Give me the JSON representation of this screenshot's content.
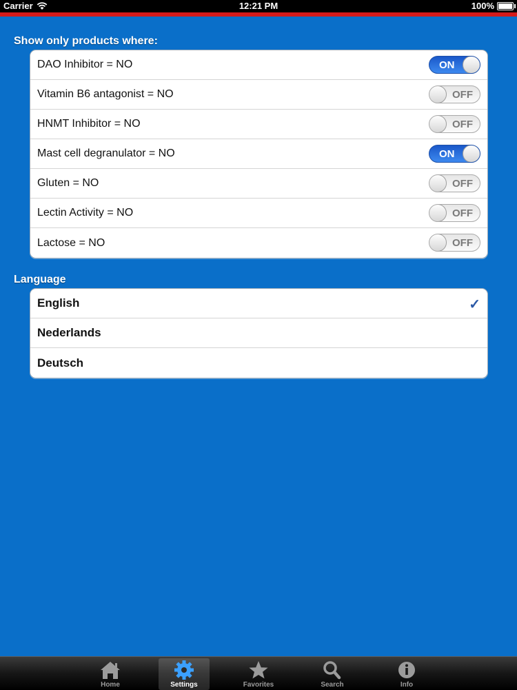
{
  "status_bar": {
    "carrier": "Carrier",
    "time": "12:21 PM",
    "battery": "100%"
  },
  "filters": {
    "title": "Show only products where:",
    "items": [
      {
        "label": "DAO Inhibitor = NO",
        "state": "ON"
      },
      {
        "label": "Vitamin B6 antagonist = NO",
        "state": "OFF"
      },
      {
        "label": "HNMT Inhibitor = NO",
        "state": "OFF"
      },
      {
        "label": "Mast cell degranulator = NO",
        "state": "ON"
      },
      {
        "label": "Gluten = NO",
        "state": "OFF"
      },
      {
        "label": "Lectin Activity = NO",
        "state": "OFF"
      },
      {
        "label": "Lactose = NO",
        "state": "OFF"
      }
    ]
  },
  "language": {
    "title": "Language",
    "items": [
      {
        "label": "English",
        "check": "✓"
      },
      {
        "label": "Nederlands"
      },
      {
        "label": "Deutsch"
      }
    ]
  },
  "tabbar": {
    "tabs": [
      {
        "label": "Home",
        "icon": "home-icon"
      },
      {
        "label": "Settings",
        "icon": "gear-icon"
      },
      {
        "label": "Favorites",
        "icon": "star-icon"
      },
      {
        "label": "Search",
        "icon": "search-icon"
      },
      {
        "label": "Info",
        "icon": "info-icon"
      }
    ],
    "active": "Settings"
  },
  "colors": {
    "background": "#0a6fc9",
    "toggle_on": "#2a73e0",
    "status_red_line": "#d41a1a",
    "checkmark": "#2b59a6"
  }
}
